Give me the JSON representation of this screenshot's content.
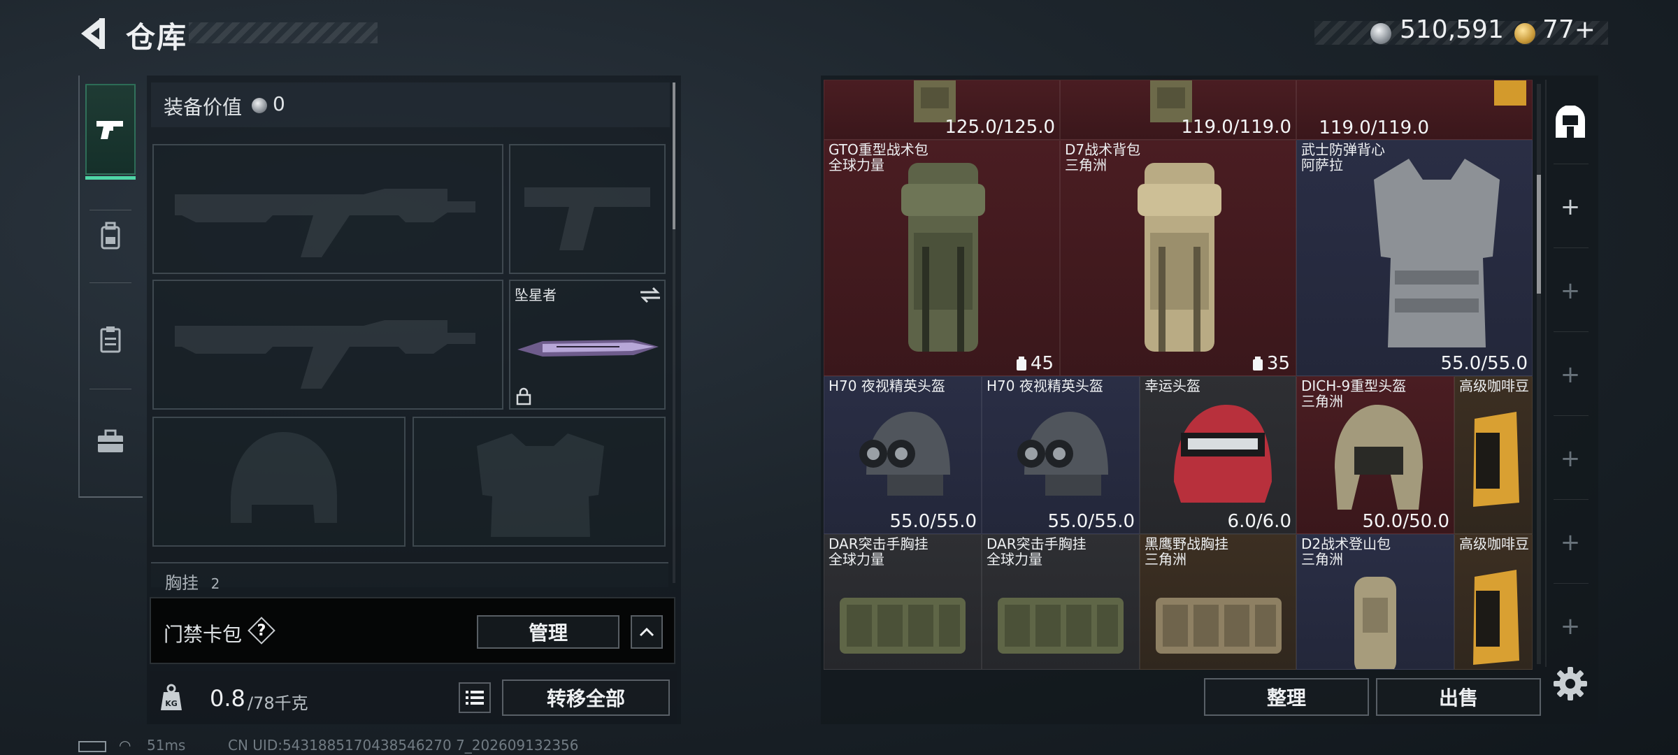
{
  "header": {
    "title": "仓库",
    "currency_money": "510,591",
    "currency_bonds": "77+"
  },
  "equipment": {
    "value_label": "装备价值",
    "value": "0",
    "melee_name": "坠星者",
    "chest_label": "胸挂",
    "chest_count": "2"
  },
  "keycard": {
    "label": "门禁卡包",
    "help": "?",
    "manage_label": "管理"
  },
  "capacity": {
    "current": "0.8",
    "max": "/78千克",
    "transfer_all_label": "转移全部"
  },
  "status": {
    "ping": "51ms",
    "uid": "CN UID:5431885170438546270 7_202609132356"
  },
  "stash": {
    "top_row": [
      {
        "durability": "125.0/125.0"
      },
      {
        "durability": "119.0/119.0"
      }
    ],
    "items": [
      {
        "name": "GTO重型战术包",
        "sub": "全球力量",
        "capacity": "45"
      },
      {
        "name": "D7战术背包",
        "sub": "三角洲",
        "capacity": "35"
      },
      {
        "name": "武士防弹背心",
        "sub": "阿萨拉",
        "durability": "55.0/55.0"
      },
      {
        "name": "H70 夜视精英头盔",
        "sub": "",
        "durability": "55.0/55.0"
      },
      {
        "name": "H70 夜视精英头盔",
        "sub": "",
        "durability": "55.0/55.0"
      },
      {
        "name": "幸运头盔",
        "sub": "",
        "durability": "6.0/6.0"
      },
      {
        "name": "DICH-9重型头盔",
        "sub": "三角洲",
        "durability": "50.0/50.0"
      },
      {
        "name": "高级咖啡豆",
        "sub": ""
      },
      {
        "name": "DAR突击手胸挂",
        "sub": "全球力量"
      },
      {
        "name": "DAR突击手胸挂",
        "sub": "全球力量"
      },
      {
        "name": "黑鹰野战胸挂",
        "sub": "三角洲"
      },
      {
        "name": "D2战术登山包",
        "sub": "三角洲"
      },
      {
        "name": "高级咖啡豆",
        "sub": ""
      }
    ],
    "sort_label": "整理",
    "sell_label": "出售"
  },
  "colors": {
    "accent_green": "#4fd6a6",
    "rarity_red": "#4a1d22",
    "rarity_blue": "#2a2e45",
    "rarity_gold": "#3c2f22"
  },
  "icons": [
    "back-arrow-icon",
    "silver-coin-icon",
    "gold-coin-icon",
    "pistol-icon",
    "backpack-icon",
    "clipboard-icon",
    "toolbox-icon",
    "lock-icon",
    "swap-icon",
    "home-icon",
    "plus-icon",
    "list-icon",
    "kg-weight-icon",
    "gear-icon"
  ]
}
